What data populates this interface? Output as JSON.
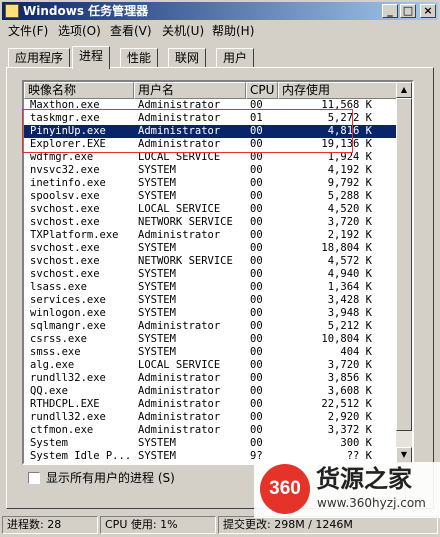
{
  "window": {
    "title": "Windows 任务管理器"
  },
  "menu": {
    "items": [
      "文件(F)",
      "选项(O)",
      "查看(V)",
      "关机(U)",
      "帮助(H)"
    ]
  },
  "tabs": [
    "应用程序",
    "进程",
    "性能",
    "联网",
    "用户"
  ],
  "active_tab": "进程",
  "columns": [
    "映像名称",
    "用户名",
    "CPU",
    "内存使用"
  ],
  "processes": [
    {
      "name": "Maxthon.exe",
      "user": "Administrator",
      "cpu": "00",
      "mem": "11,568 K"
    },
    {
      "name": "taskmgr.exe",
      "user": "Administrator",
      "cpu": "01",
      "mem": "5,272 K"
    },
    {
      "name": "PinyinUp.exe",
      "user": "Administrator",
      "cpu": "00",
      "mem": "4,816 K"
    },
    {
      "name": "Explorer.EXE",
      "user": "Administrator",
      "cpu": "00",
      "mem": "19,136 K"
    },
    {
      "name": "wdfmgr.exe",
      "user": "LOCAL SERVICE",
      "cpu": "00",
      "mem": "1,924 K"
    },
    {
      "name": "nvsvc32.exe",
      "user": "SYSTEM",
      "cpu": "00",
      "mem": "4,192 K"
    },
    {
      "name": "inetinfo.exe",
      "user": "SYSTEM",
      "cpu": "00",
      "mem": "9,792 K"
    },
    {
      "name": "spoolsv.exe",
      "user": "SYSTEM",
      "cpu": "00",
      "mem": "5,288 K"
    },
    {
      "name": "svchost.exe",
      "user": "LOCAL SERVICE",
      "cpu": "00",
      "mem": "4,520 K"
    },
    {
      "name": "svchost.exe",
      "user": "NETWORK SERVICE",
      "cpu": "00",
      "mem": "3,720 K"
    },
    {
      "name": "TXPlatform.exe",
      "user": "Administrator",
      "cpu": "00",
      "mem": "2,192 K"
    },
    {
      "name": "svchost.exe",
      "user": "SYSTEM",
      "cpu": "00",
      "mem": "18,804 K"
    },
    {
      "name": "svchost.exe",
      "user": "NETWORK SERVICE",
      "cpu": "00",
      "mem": "4,572 K"
    },
    {
      "name": "svchost.exe",
      "user": "SYSTEM",
      "cpu": "00",
      "mem": "4,940 K"
    },
    {
      "name": "lsass.exe",
      "user": "SYSTEM",
      "cpu": "00",
      "mem": "1,364 K"
    },
    {
      "name": "services.exe",
      "user": "SYSTEM",
      "cpu": "00",
      "mem": "3,428 K"
    },
    {
      "name": "winlogon.exe",
      "user": "SYSTEM",
      "cpu": "00",
      "mem": "3,948 K"
    },
    {
      "name": "sqlmangr.exe",
      "user": "Administrator",
      "cpu": "00",
      "mem": "5,212 K"
    },
    {
      "name": "csrss.exe",
      "user": "SYSTEM",
      "cpu": "00",
      "mem": "10,804 K"
    },
    {
      "name": "smss.exe",
      "user": "SYSTEM",
      "cpu": "00",
      "mem": "404 K"
    },
    {
      "name": "alg.exe",
      "user": "LOCAL SERVICE",
      "cpu": "00",
      "mem": "3,720 K"
    },
    {
      "name": "rundll32.exe",
      "user": "Administrator",
      "cpu": "00",
      "mem": "3,856 K"
    },
    {
      "name": "QQ.exe",
      "user": "Administrator",
      "cpu": "00",
      "mem": "3,608 K"
    },
    {
      "name": "RTHDCPL.EXE",
      "user": "Administrator",
      "cpu": "00",
      "mem": "22,512 K"
    },
    {
      "name": "rundll32.exe",
      "user": "Administrator",
      "cpu": "00",
      "mem": "2,920 K"
    },
    {
      "name": "ctfmon.exe",
      "user": "Administrator",
      "cpu": "00",
      "mem": "3,372 K"
    },
    {
      "name": "System",
      "user": "SYSTEM",
      "cpu": "00",
      "mem": "300 K"
    },
    {
      "name": "System Idle P...",
      "user": "SYSTEM",
      "cpu": "9?",
      "mem": "?? K"
    }
  ],
  "selected_index": 2,
  "show_all_users_label": "显示所有用户的进程 (S)",
  "status": {
    "processes": "进程数: 28",
    "cpu": "CPU 使用: 1%",
    "commit": "提交更改: 298M / 1246M"
  },
  "watermark": {
    "logo": "360",
    "title": "货源之家",
    "url": "www.360hyzj.com"
  },
  "colors": {
    "title_start": "#0a246a",
    "title_end": "#a6caf0",
    "selection": "#0a246a",
    "annotation": "#e0342c",
    "logo": "#e6332a"
  }
}
